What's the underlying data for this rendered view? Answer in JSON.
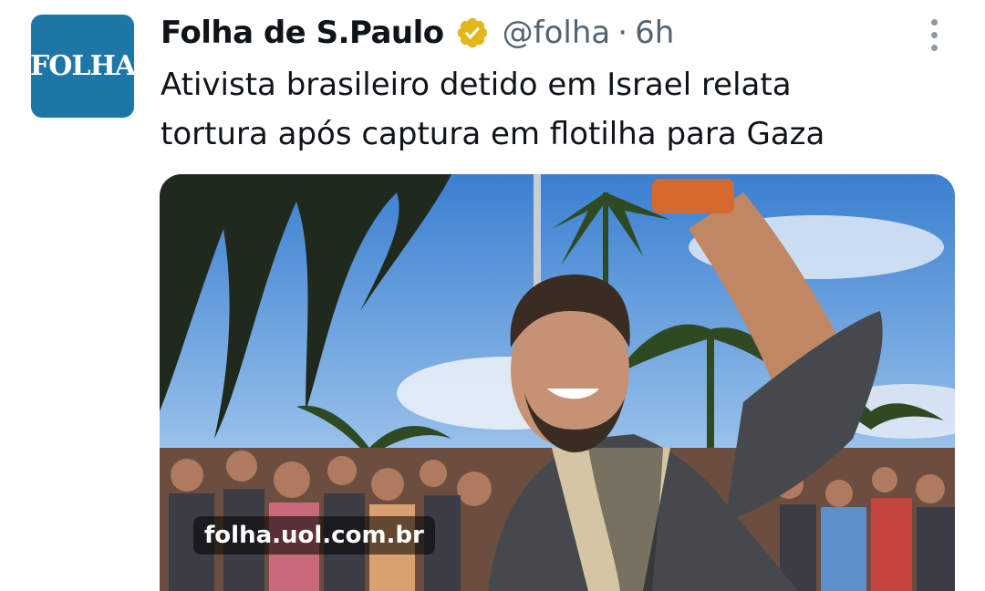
{
  "avatar": {
    "text": "FOLHA",
    "bg_color": "#1d76a6"
  },
  "header": {
    "display_name": "Folha de S.Paulo",
    "verified_icon": "verified-gold-badge-icon",
    "verified_color": "#e2b719",
    "handle": "@folha",
    "separator": "·",
    "time": "6h"
  },
  "menu": {
    "icon": "more-vertical-icon"
  },
  "tweet": {
    "text_line1": "Ativista brasileiro detido em Israel relata",
    "text_line2": "tortura após captura em flotilha para Gaza"
  },
  "media": {
    "link_domain": "folha.uol.com.br"
  }
}
